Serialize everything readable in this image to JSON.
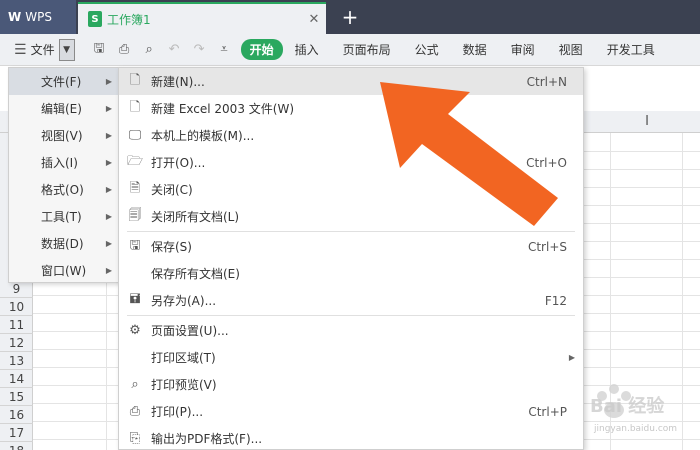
{
  "titlebar": {
    "app_name": "WPS",
    "doc_tab_title": "工作簿1",
    "doc_icon_letter": "S",
    "close_glyph": "✕",
    "new_tab_glyph": "+"
  },
  "ribbon": {
    "menu_label": "文件",
    "start_label": "开始",
    "tabs": [
      "插入",
      "页面布局",
      "公式",
      "数据",
      "审阅",
      "视图",
      "开发工具"
    ]
  },
  "sheet": {
    "visible_column_header": "I",
    "row_numbers": [
      "9",
      "10",
      "11",
      "12",
      "13",
      "14",
      "15",
      "16",
      "17",
      "18"
    ]
  },
  "left_menu": {
    "items": [
      {
        "label": "文件(F)",
        "active": true
      },
      {
        "label": "编辑(E)"
      },
      {
        "label": "视图(V)"
      },
      {
        "label": "插入(I)"
      },
      {
        "label": "格式(O)"
      },
      {
        "label": "工具(T)"
      },
      {
        "label": "数据(D)"
      },
      {
        "label": "窗口(W)"
      }
    ]
  },
  "file_menu": {
    "items": [
      {
        "icon": "new-file-icon",
        "label": "新建(N)...",
        "shortcut": "Ctrl+N",
        "hover": true
      },
      {
        "icon": "new-file-icon",
        "label": "新建 Excel 2003 文件(W)"
      },
      {
        "icon": "monitor-template-icon",
        "label": "本机上的模板(M)..."
      },
      {
        "icon": "folder-open-icon",
        "label": "打开(O)...",
        "shortcut": "Ctrl+O"
      },
      {
        "icon": "close-doc-icon",
        "label": "关闭(C)"
      },
      {
        "icon": "close-all-docs-icon",
        "label": "关闭所有文档(L)"
      },
      {
        "icon": "save-icon",
        "label": "保存(S)",
        "shortcut": "Ctrl+S"
      },
      {
        "icon": "",
        "label": "保存所有文档(E)"
      },
      {
        "icon": "save-as-icon",
        "label": "另存为(A)...",
        "shortcut": "F12"
      },
      {
        "icon": "page-setup-icon",
        "label": "页面设置(U)..."
      },
      {
        "icon": "",
        "label": "打印区域(T)",
        "submenu": true
      },
      {
        "icon": "print-preview-icon",
        "label": "打印预览(V)"
      },
      {
        "icon": "printer-icon",
        "label": "打印(P)...",
        "shortcut": "Ctrl+P"
      },
      {
        "icon": "pdf-export-icon",
        "label": "输出为PDF格式(F)..."
      }
    ]
  },
  "watermark": {
    "text": "Bai 经验",
    "url": "jingyan.baidu.com"
  },
  "colors": {
    "accent_green": "#2aa85f",
    "arrow_orange": "#f26522",
    "titlebar_dark": "#3b4151"
  }
}
